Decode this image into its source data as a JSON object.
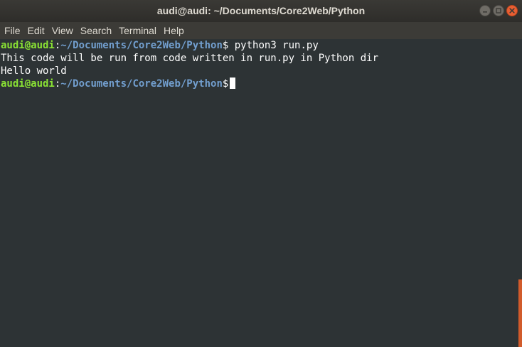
{
  "window": {
    "title": "audi@audi: ~/Documents/Core2Web/Python"
  },
  "menubar": {
    "items": [
      "File",
      "Edit",
      "View",
      "Search",
      "Terminal",
      "Help"
    ]
  },
  "terminal": {
    "prompt_user": "audi@audi",
    "prompt_colon": ":",
    "prompt_path": "~/Documents/Core2Web/Python",
    "prompt_dollar": "$",
    "command": " python3 run.py",
    "output": [
      "This code will be run from code written in run.py in Python dir",
      "Hello world"
    ]
  },
  "scrollbar": {
    "position": 0.78,
    "visible_fraction": 0.22
  },
  "colors": {
    "background": "#2d3335",
    "prompt_user": "#8ae234",
    "prompt_path": "#729fcf",
    "scroll_thumb": "#d15b2b",
    "close_button": "#e85e32"
  }
}
